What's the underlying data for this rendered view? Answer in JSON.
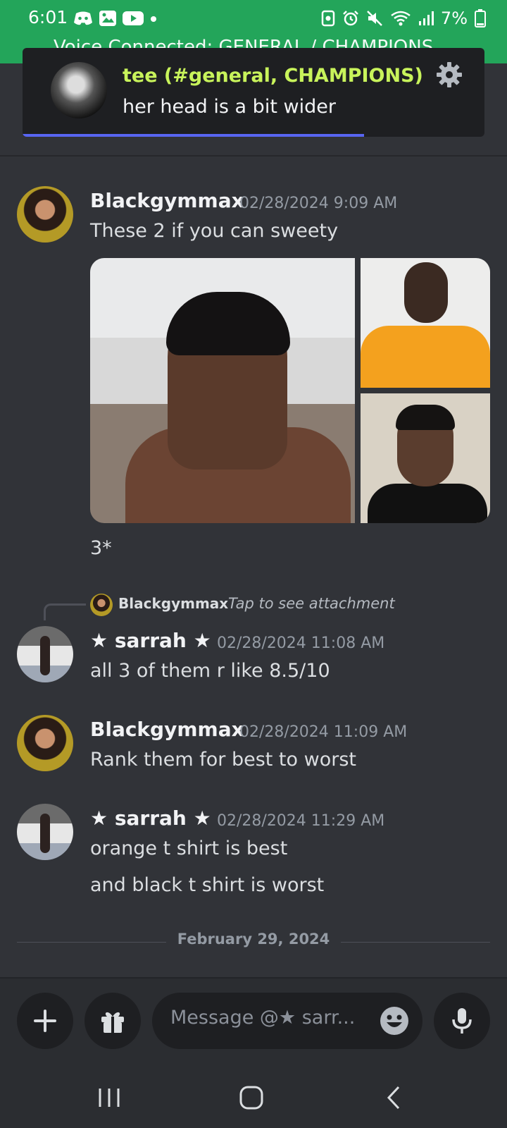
{
  "status_bar": {
    "time": "6:01",
    "battery": "7%",
    "voice_banner": "Voice Connected: GENERAL / CHAMPIONS"
  },
  "notification": {
    "title": "tee (#general, CHAMPIONS)",
    "body": "her head is a bit wider",
    "progress": 0.74
  },
  "messages": [
    {
      "author": "Blackgymmax",
      "timestamp": "02/28/2024 9:09 AM",
      "lines": [
        "These 2 if you can sweety"
      ],
      "attachments_count": 3,
      "followup": "3*"
    },
    {
      "reply_to": {
        "author": "Blackgymmax",
        "text": "Tap to see attachment"
      },
      "author": "★ sarrah ★",
      "timestamp": "02/28/2024 11:08 AM",
      "lines": [
        "all 3 of them r like 8.5/10"
      ]
    },
    {
      "author": "Blackgymmax",
      "timestamp": "02/28/2024 11:09 AM",
      "lines": [
        "Rank them for best to worst"
      ]
    },
    {
      "author": "★ sarrah ★",
      "timestamp": "02/28/2024 11:29 AM",
      "lines": [
        "orange t shirt is best",
        "and black t shirt is worst"
      ]
    }
  ],
  "date_divider": "February 29, 2024",
  "composer": {
    "placeholder": "Message @★ sarr..."
  },
  "colors": {
    "status_green": "#23a55a",
    "background": "#313338",
    "accent": "#5865f2",
    "notif_title": "#c8f35b"
  },
  "icons": [
    "discord-icon",
    "gallery-icon",
    "youtube-icon",
    "gear-icon",
    "plus-icon",
    "gift-icon",
    "emoji-icon",
    "mic-icon",
    "recents-icon",
    "home-icon",
    "back-icon"
  ]
}
